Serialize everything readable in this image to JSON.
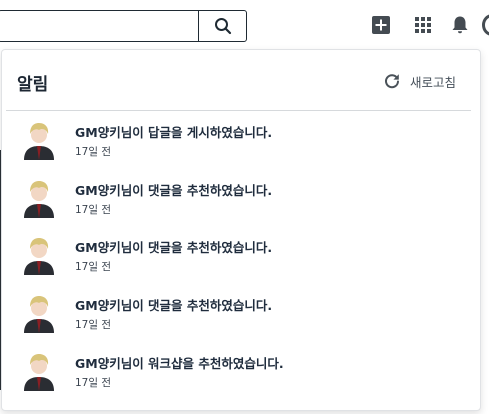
{
  "colors": {
    "icon": "#444b52",
    "title": "#1d2733",
    "border": "#1f2a33"
  },
  "topbar": {
    "search_icon": "search-icon",
    "icons": [
      "plus-square-icon",
      "apps-grid-icon",
      "bell-icon"
    ]
  },
  "panel": {
    "title": "알림",
    "refresh_label": "새로고침",
    "refresh_icon": "refresh-icon",
    "items": [
      {
        "text": "GM양키님이 답글을 게시하였습니다.",
        "time": "17일 전"
      },
      {
        "text": "GM양키님이 댓글을 추천하였습니다.",
        "time": "17일 전"
      },
      {
        "text": "GM양키님이 댓글을 추천하였습니다.",
        "time": "17일 전"
      },
      {
        "text": "GM양키님이 댓글을 추천하였습니다.",
        "time": "17일 전"
      },
      {
        "text": "GM양키님이 워크샵을 추천하였습니다.",
        "time": "17일 전"
      }
    ]
  }
}
